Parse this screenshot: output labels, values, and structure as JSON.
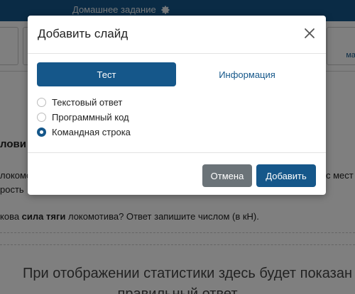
{
  "topbar": {
    "title": "Домашнее задание",
    "title_icon": "gear-icon"
  },
  "toolbar": {
    "right_fragment": "ма"
  },
  "background": {
    "heading_fragment": "лови",
    "line1_left": "локомот",
    "line1_right": "с мест",
    "line2_left": "рость",
    "question_prefix": "кова ",
    "question_bold": "сила тяги",
    "question_suffix": " локомотива? Ответ запишите числом (в кН).",
    "stats_line1": "При отображении статистики здесь будет показан",
    "stats_line2": "правильный ответ"
  },
  "modal": {
    "title": "Добавить слайд",
    "close_icon": "close-icon",
    "tabs": [
      {
        "label": "Тест",
        "active": true
      },
      {
        "label": "Информация",
        "active": false
      }
    ],
    "options": [
      {
        "label": "Текстовый ответ",
        "checked": false
      },
      {
        "label": "Программный код",
        "checked": false
      },
      {
        "label": "Командная строка",
        "checked": true
      }
    ],
    "cancel_label": "Отмена",
    "add_label": "Добавить"
  },
  "colors": {
    "primary": "#15578a",
    "secondary_button": "#6b7378",
    "overlay": "rgba(0,0,0,0.5)"
  }
}
